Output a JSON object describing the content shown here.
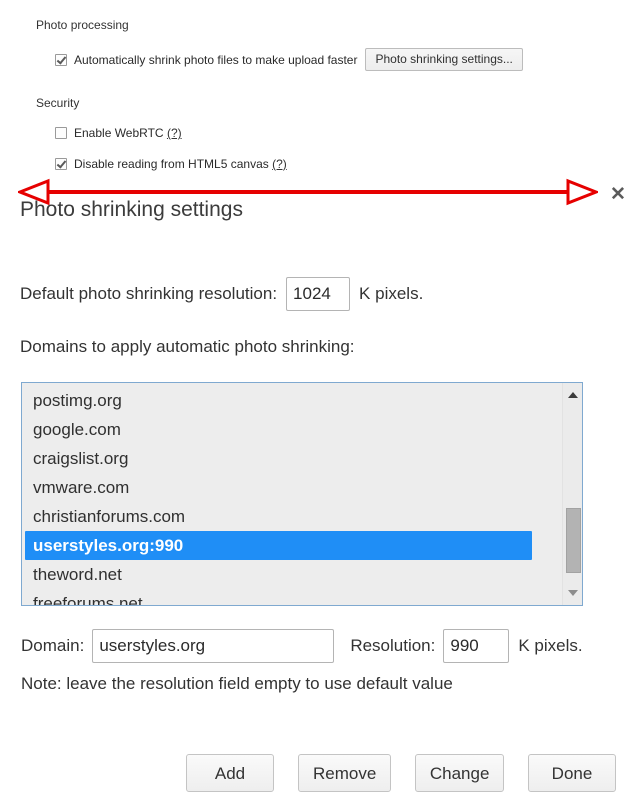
{
  "options": {
    "photo_processing_title": "Photo processing",
    "auto_shrink_label": "Automatically shrink photo files to make upload faster",
    "auto_shrink_checked": "checked",
    "photo_shrinking_settings_button": "Photo shrinking settings...",
    "security_title": "Security",
    "enable_webrtc_label": "Enable WebRTC",
    "enable_webrtc_help": "(?)",
    "enable_webrtc_checked": "unchecked",
    "disable_canvas_label": "Disable reading from HTML5 canvas",
    "disable_canvas_help": "(?)",
    "disable_canvas_checked": "checked"
  },
  "annotation": {
    "arrow_color": "#e60000",
    "arrow_kind": "double-headed-horizontal-arrow"
  },
  "dialog": {
    "title": "Photo shrinking settings",
    "close_label": "✕",
    "default_resolution_label": "Default photo shrinking resolution:",
    "default_resolution_value": "1024",
    "default_resolution_unit": "K pixels.",
    "domains_label": "Domains to apply automatic photo shrinking:",
    "domain_list": [
      "postimg.org",
      "google.com",
      "craigslist.org",
      "vmware.com",
      "christianforums.com",
      "userstyles.org:990",
      "theword.net",
      "freeforums.net"
    ],
    "selected_index": 5,
    "selection_color": "#1f8ef6",
    "domain_field_label": "Domain:",
    "domain_field_value": "userstyles.org",
    "resolution_field_label": "Resolution:",
    "resolution_field_value": "990",
    "resolution_field_unit": "K pixels.",
    "note": "Note: leave the resolution field empty to use default value",
    "buttons": [
      "Add",
      "Remove",
      "Change",
      "Done"
    ]
  }
}
